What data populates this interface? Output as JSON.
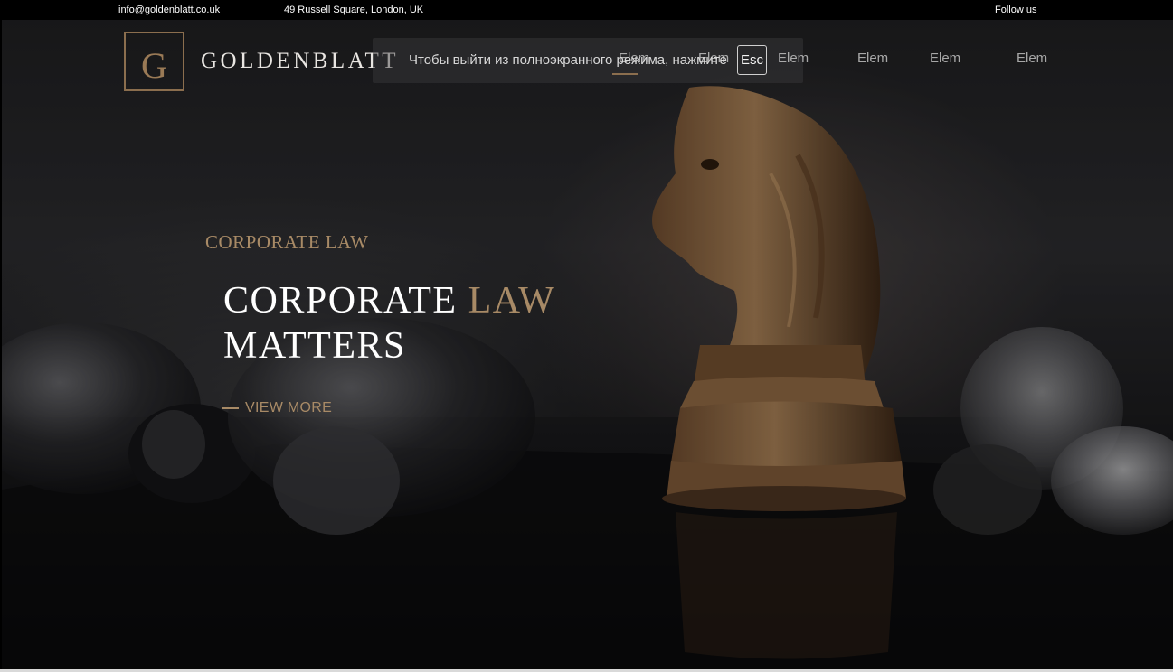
{
  "topbar": {
    "email": "info@goldenblatt.co.uk",
    "address": "49 Russell Square, London, UK",
    "follow": "Follow us"
  },
  "logo": {
    "letter": "G",
    "name": "GOLDENBLATT"
  },
  "fullscreen_toast": {
    "message": "Чтобы выйти из полноэкранного режима, нажмите",
    "key": "Esc"
  },
  "nav": {
    "items": [
      {
        "label": "Elem"
      },
      {
        "label": "Elem"
      },
      {
        "label": "Elem"
      },
      {
        "label": "Elem"
      },
      {
        "label": "Elem"
      },
      {
        "label": "Elem"
      }
    ]
  },
  "hero": {
    "eyebrow": "CORPORATE LAW",
    "headline_part1": "CORPORATE",
    "headline_accent": "LAW",
    "headline_line2": "MATTERS",
    "cta": "VIEW MORE"
  },
  "colors": {
    "accent": "#a88a66",
    "topbar_bg": "#000000",
    "text_light": "#ffffff"
  }
}
